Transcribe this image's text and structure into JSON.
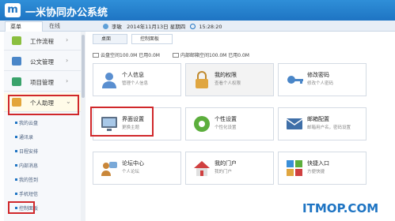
{
  "header": {
    "logo_text": "m",
    "title": "一米协同办公系统"
  },
  "toolbar": {
    "tab_menu": "菜单",
    "tab_online": "在线",
    "user": "李敏",
    "date": "2014年11月13日 星期四",
    "time": "15:28:20"
  },
  "sidebar": {
    "items": [
      {
        "label": "工作流程",
        "icon": "workflow-icon",
        "color": "#8bbf3f"
      },
      {
        "label": "公文管理",
        "icon": "folder-icon",
        "color": "#4a86c8"
      },
      {
        "label": "项目管理",
        "icon": "project-icon",
        "color": "#3aa36b"
      },
      {
        "label": "个人助理",
        "icon": "assistant-icon",
        "color": "#e3a53a"
      }
    ],
    "sub_items": [
      "我的云盘",
      "通讯录",
      "日程安排",
      "内部消息",
      "我的签到",
      "手机短信",
      "控制面板"
    ]
  },
  "content": {
    "tabs": [
      "桌面",
      "控制面板"
    ],
    "storage": [
      "云盘空间100.0M 已用0.0M",
      "内部邮箱空间100.0M 已用0.0M"
    ],
    "cards": [
      {
        "title": "个人信息",
        "desc": "管理个人信息",
        "icon": "person-icon",
        "color": "#5a8fd0"
      },
      {
        "title": "我的权限",
        "desc": "查看个人权限",
        "icon": "lock-icon",
        "color": "#e0a640"
      },
      {
        "title": "修改密码",
        "desc": "修改个人密码",
        "icon": "key-icon",
        "color": "#4a86c8"
      },
      {
        "title": "界面设置",
        "desc": "更换主题",
        "icon": "monitor-icon",
        "color": "#5c6f86"
      },
      {
        "title": "个性设置",
        "desc": "个性化设置",
        "icon": "gear-icon",
        "color": "#5cae3c"
      },
      {
        "title": "邮箱配置",
        "desc": "邮箱用户名，密码设置",
        "icon": "mail-icon",
        "color": "#3f6fa8"
      },
      {
        "title": "论坛中心",
        "desc": "个人论坛",
        "icon": "forum-icon",
        "color": "#c9873a"
      },
      {
        "title": "我的门户",
        "desc": "我的门户",
        "icon": "home-icon",
        "color": "#d04040"
      },
      {
        "title": "快捷入口",
        "desc": "方便快捷",
        "icon": "shortcut-icon",
        "color": "#3a8fd8"
      }
    ]
  },
  "watermark": "ITMOP.COM"
}
